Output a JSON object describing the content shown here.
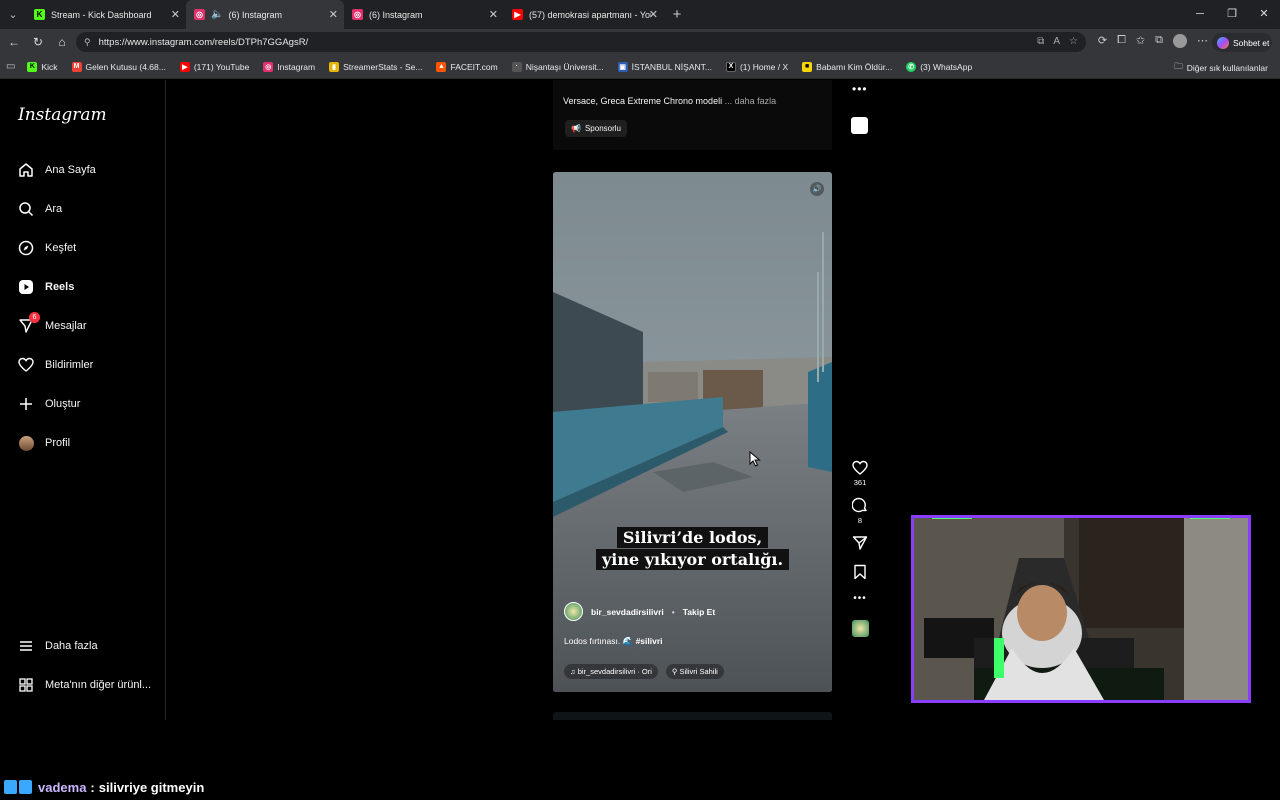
{
  "browser": {
    "tabs": [
      {
        "label": "Stream - Kick Dashboard",
        "icon": "kick-icon",
        "color": "#53fc18"
      },
      {
        "label": "(6) Instagram",
        "icon": "instagram-icon",
        "color": "#e1306c",
        "active": true
      },
      {
        "label": "(6) Instagram",
        "icon": "instagram-icon",
        "color": "#e1306c"
      },
      {
        "label": "(57) demokrasi apartmanı - YouTu",
        "icon": "youtube-icon",
        "color": "#ff0000"
      }
    ],
    "url": "https://www.instagram.com/reels/DTPh7GGAgsR/",
    "copilot_label": "Sohbet et",
    "bookmarks": [
      {
        "label": "Kick",
        "color": "#53fc18"
      },
      {
        "label": "Gelen Kutusu (4.68...",
        "color": "#ea4335"
      },
      {
        "label": "(171) YouTube",
        "color": "#ff0000"
      },
      {
        "label": "Instagram",
        "color": "#e1306c"
      },
      {
        "label": "StreamerStats - Se...",
        "color": "#e8b400"
      },
      {
        "label": "FACEIT.com",
        "color": "#ff5500"
      },
      {
        "label": "Nişantaşı Üniversit...",
        "color": "#555555"
      },
      {
        "label": "İSTANBUL NİŞANT...",
        "color": "#2b5fb3"
      },
      {
        "label": "(1) Home / X",
        "color": "#000000"
      },
      {
        "label": "Babamı Kim Öldür...",
        "color": "#f5d400"
      },
      {
        "label": "(3) WhatsApp",
        "color": "#25d366"
      }
    ],
    "bookmarks_other": "Diğer sık kullanılanlar"
  },
  "sidebar": {
    "logo": "Instagram",
    "items": [
      {
        "label": "Ana Sayfa",
        "icon": "home-icon"
      },
      {
        "label": "Ara",
        "icon": "search-icon"
      },
      {
        "label": "Keşfet",
        "icon": "compass-icon"
      },
      {
        "label": "Reels",
        "icon": "reels-icon"
      },
      {
        "label": "Mesajlar",
        "icon": "messages-icon",
        "badge": "6"
      },
      {
        "label": "Bildirimler",
        "icon": "heart-icon"
      },
      {
        "label": "Oluştur",
        "icon": "plus-icon"
      },
      {
        "label": "Profil",
        "icon": "profile-avatar"
      }
    ],
    "more": "Daha fazla",
    "meta": "Meta'nın diğer ürünl..."
  },
  "prev_post": {
    "caption": "Versace, Greca Extreme Chrono modeli",
    "more": "... daha fazla",
    "sponsored": "Sponsorlu"
  },
  "reel": {
    "overlay_line1": "Silivri’de lodos,",
    "overlay_line2": "yine yıkıyor ortalığı.",
    "username": "bir_sevdadirsilivri",
    "separator": "•",
    "follow": "Takip Et",
    "description": "Lodos fırtınası.",
    "hashtag": "#silivri",
    "audio": "bir_sevdadirsilivri · Ori",
    "location": "Silivri Sahili",
    "likes": "361",
    "comments": "8"
  },
  "stream_chat": {
    "username": "vadema",
    "separator": ":",
    "message": "silivriye gitmeyin"
  }
}
